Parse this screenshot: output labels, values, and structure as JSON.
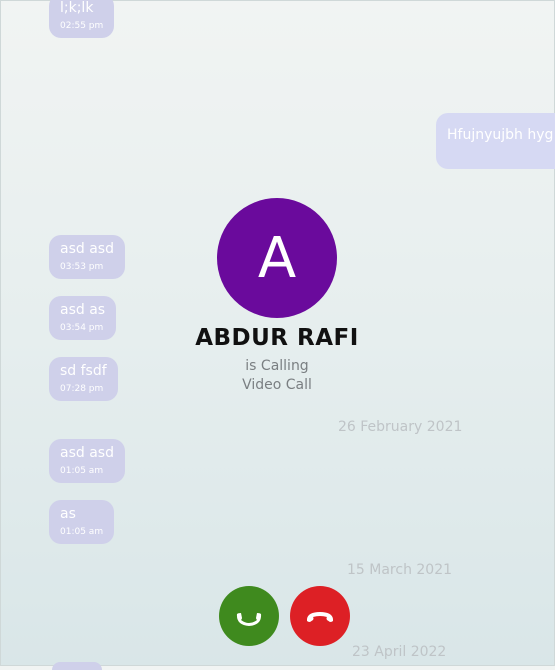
{
  "messages": [
    {
      "text": "l;k;lk",
      "time": "02:55 pm"
    },
    {
      "text": "asd asd",
      "time": "03:53 pm"
    },
    {
      "text": "asd as",
      "time": "03:54 pm"
    },
    {
      "text": "sd fsdf",
      "time": "07:28 pm"
    },
    {
      "text": "asd asd",
      "time": "01:05 am"
    },
    {
      "text": "as",
      "time": "01:05 am"
    }
  ],
  "outgoing": {
    "text": "Hfujnyujbh hyg"
  },
  "date_separators": [
    "26 February 2021",
    "15 March 2021",
    "23 April 2022"
  ],
  "call": {
    "avatar_letter": "A",
    "caller_name": "ABDUR RAFI",
    "status": "is Calling",
    "type": "Video Call",
    "avatar_color": "#6a0a9c",
    "accept_color": "#3f8a1e",
    "decline_color": "#dd2025",
    "accept_icon": "phone-icon",
    "decline_icon": "phone-hangup-icon"
  }
}
